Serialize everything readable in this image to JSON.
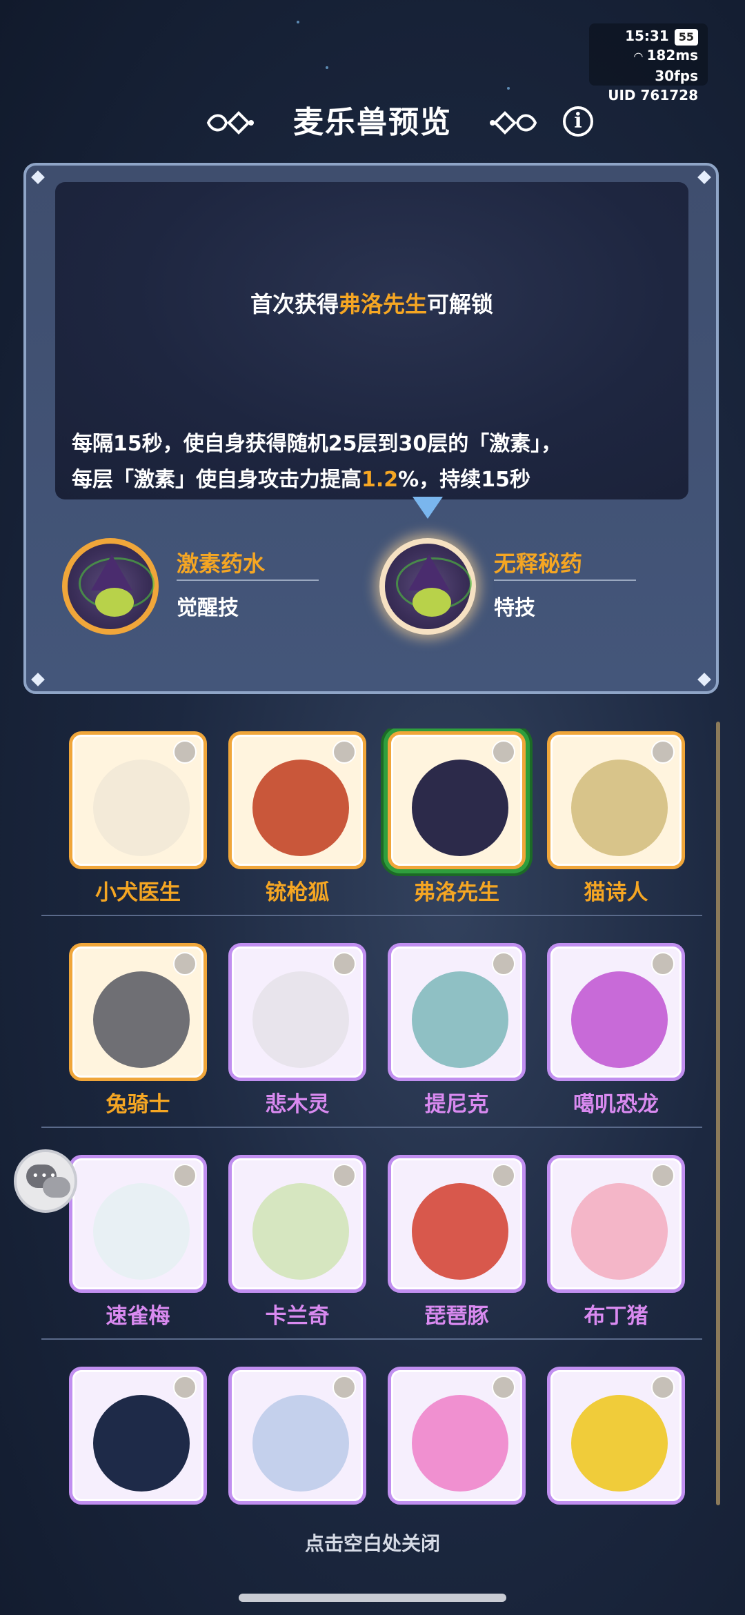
{
  "status": {
    "time": "15:31",
    "battery": "55",
    "ping": "182ms",
    "fps": "30fps",
    "uid": "UID  761728"
  },
  "header": {
    "title": "麦乐兽预览"
  },
  "preview": {
    "unlock_prefix": "首次获得",
    "unlock_name": "弗洛先生",
    "unlock_suffix": "可解锁",
    "desc_line1": "每隔15秒，使自身获得随机25层到30层的「激素」，",
    "desc_line2_a": "每层「激素」使自身攻击力提高",
    "desc_line2_num": "1.2",
    "desc_line2_b": "%，持续15秒",
    "skills": [
      {
        "name": "激素药水",
        "type": "觉醒技"
      },
      {
        "name": "无释秘药",
        "type": "特技"
      }
    ]
  },
  "colors": {
    "accent": "#f5a623",
    "rare_purple": "#d98af0",
    "selected": "#2f9e3d"
  },
  "monsters": [
    {
      "name": "小犬医生",
      "rarity": "gold"
    },
    {
      "name": "铳枪狐",
      "rarity": "gold"
    },
    {
      "name": "弗洛先生",
      "rarity": "gold",
      "selected": true
    },
    {
      "name": "猫诗人",
      "rarity": "gold"
    },
    {
      "name": "兔骑士",
      "rarity": "gold"
    },
    {
      "name": "悲木灵",
      "rarity": "purple"
    },
    {
      "name": "提尼克",
      "rarity": "purple"
    },
    {
      "name": "噶叽恐龙",
      "rarity": "purple"
    },
    {
      "name": "速雀梅",
      "rarity": "purple"
    },
    {
      "name": "卡兰奇",
      "rarity": "purple"
    },
    {
      "name": "琵琶豚",
      "rarity": "purple"
    },
    {
      "name": "布丁猪",
      "rarity": "purple"
    },
    {
      "name": "",
      "rarity": "purple"
    },
    {
      "name": "",
      "rarity": "purple"
    },
    {
      "name": "",
      "rarity": "purple"
    },
    {
      "name": "",
      "rarity": "purple"
    }
  ],
  "footer": {
    "close_hint": "点击空白处关闭"
  }
}
